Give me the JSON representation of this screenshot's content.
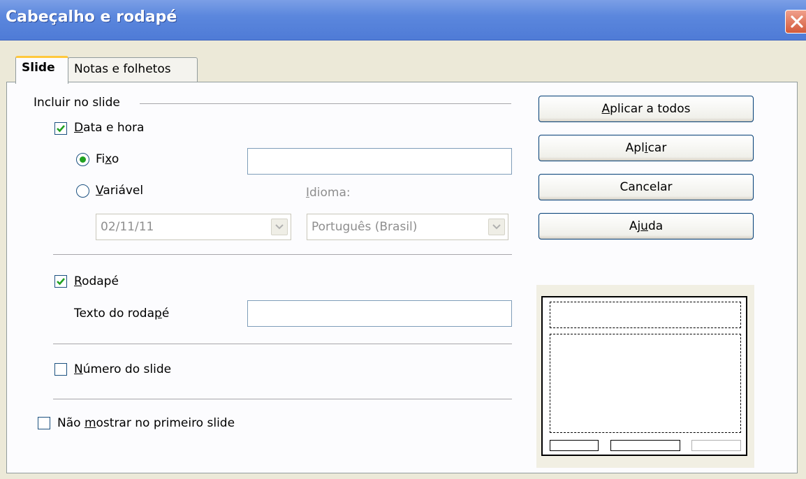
{
  "window": {
    "title": "Cabeçalho e rodapé"
  },
  "tabs": [
    {
      "label": "Slide"
    },
    {
      "label": "Notas e folhetos"
    }
  ],
  "group": {
    "title": "Incluir no slide"
  },
  "date_time": {
    "label_underline": "D",
    "label_rest": "ata e hora",
    "checked": true,
    "fixed": {
      "label_pre": "Fi",
      "label_underline": "x",
      "label_post": "o",
      "selected": true,
      "value": ""
    },
    "variable": {
      "label_underline": "V",
      "label_rest": "ariável",
      "selected": false
    },
    "format_value": "02/11/11",
    "language_label_underline": "I",
    "language_label_rest": "dioma:",
    "language_value": "Português (Brasil)"
  },
  "footer": {
    "label_underline": "R",
    "label_rest": "odapé",
    "checked": true,
    "text_label_pre": "Texto do roda",
    "text_label_underline": "p",
    "text_label_post": "é",
    "text_value": ""
  },
  "slide_number": {
    "label_underline": "N",
    "label_rest": "úmero do slide",
    "checked": false
  },
  "first_slide": {
    "label_pre": "Não ",
    "label_underline": "m",
    "label_post": "ostrar no primeiro slide",
    "checked": false
  },
  "buttons": {
    "apply_all": {
      "u": "A",
      "rest": "plicar a todos"
    },
    "apply": {
      "pre": "Apl",
      "u": "i",
      "post": "car"
    },
    "cancel": {
      "label": "Cancelar"
    },
    "help": {
      "pre": "Aj",
      "u": "u",
      "post": "da"
    }
  },
  "colors": {
    "title_bar": "#5b87dd",
    "check_mark": "#21a121",
    "dialog_bg": "#ece9d8",
    "tab_highlight": "#ffc83c"
  }
}
